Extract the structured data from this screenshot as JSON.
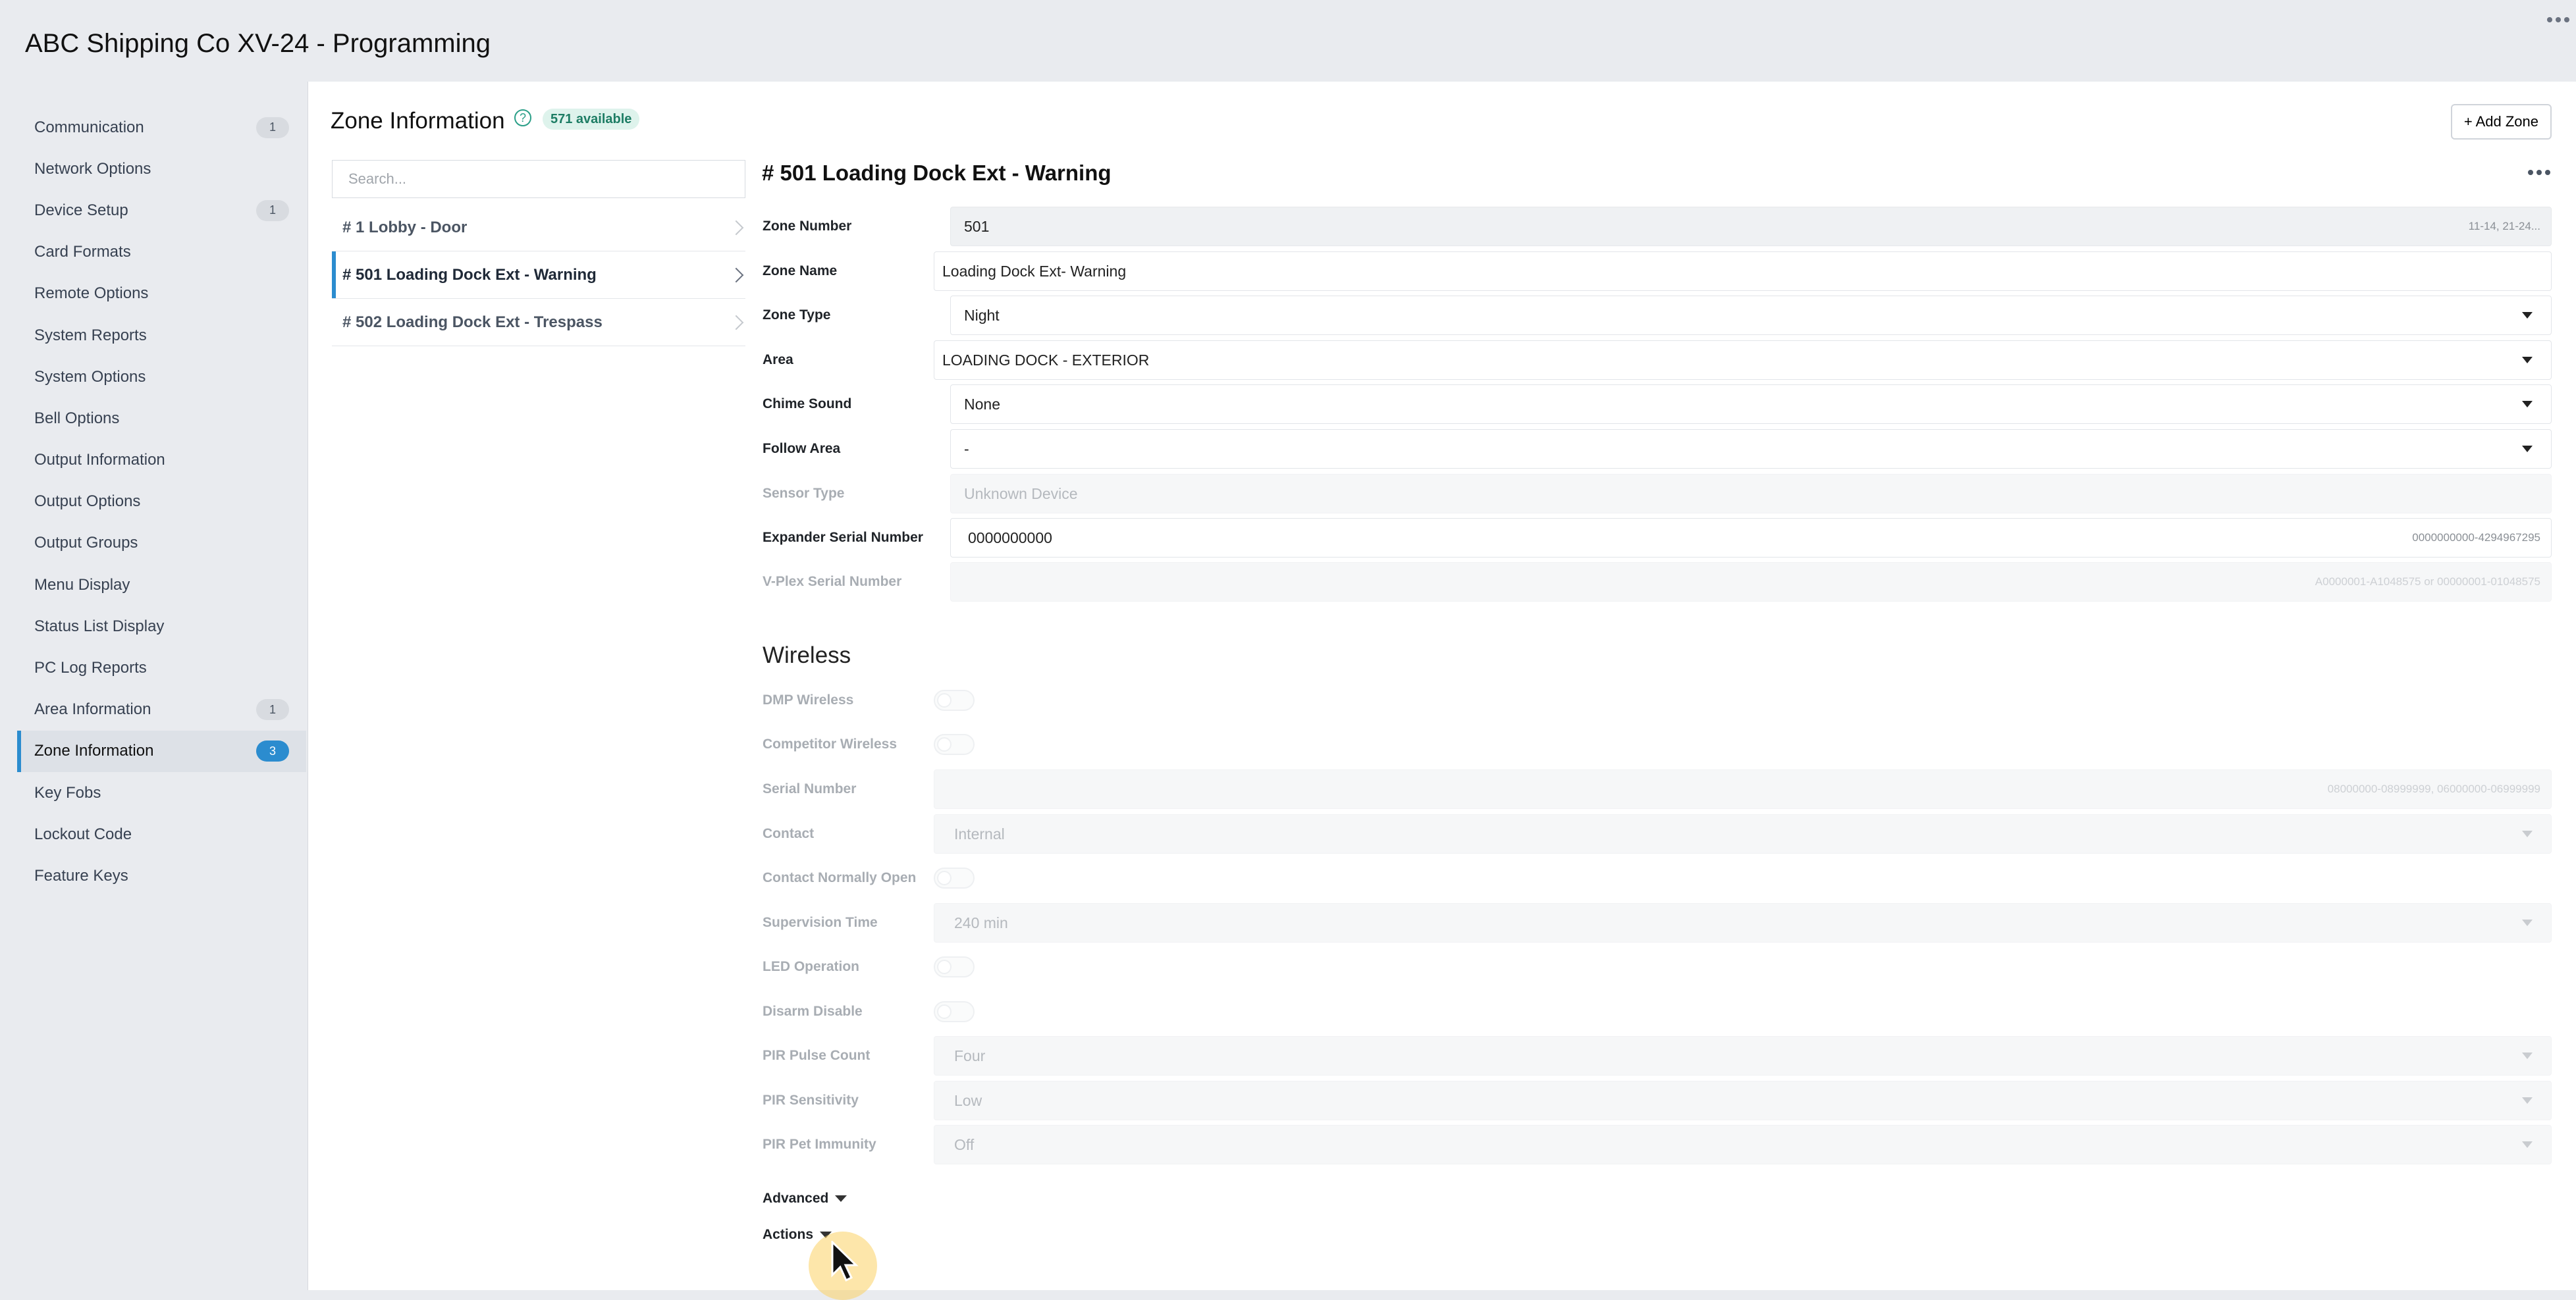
{
  "app": {
    "title": "ABC Shipping Co XV-24 - Programming"
  },
  "sidebar": {
    "items": [
      {
        "label": "Communication",
        "badge": "1"
      },
      {
        "label": "Network Options",
        "badge": ""
      },
      {
        "label": "Device Setup",
        "badge": "1"
      },
      {
        "label": "Card Formats",
        "badge": ""
      },
      {
        "label": "Remote Options",
        "badge": ""
      },
      {
        "label": "System Reports",
        "badge": ""
      },
      {
        "label": "System Options",
        "badge": ""
      },
      {
        "label": "Bell Options",
        "badge": ""
      },
      {
        "label": "Output Information",
        "badge": ""
      },
      {
        "label": "Output Options",
        "badge": ""
      },
      {
        "label": "Output Groups",
        "badge": ""
      },
      {
        "label": "Menu Display",
        "badge": ""
      },
      {
        "label": "Status List Display",
        "badge": ""
      },
      {
        "label": "PC Log Reports",
        "badge": ""
      },
      {
        "label": "Area Information",
        "badge": "1"
      },
      {
        "label": "Zone Information",
        "badge": "3"
      },
      {
        "label": "Key Fobs",
        "badge": ""
      },
      {
        "label": "Lockout Code",
        "badge": ""
      },
      {
        "label": "Feature Keys",
        "badge": ""
      }
    ],
    "active_index": 15
  },
  "header": {
    "title": "Zone Information",
    "help_icon": "?",
    "available_badge": "571 available",
    "add_button": "+ Add Zone"
  },
  "zone_list": {
    "search_placeholder": "Search...",
    "items": [
      "# 1 Lobby - Door",
      "# 501 Loading Dock Ext - Warning",
      "# 502 Loading Dock Ext - Trespass"
    ],
    "active_index": 1
  },
  "form": {
    "heading": "# 501 Loading Dock Ext - Warning",
    "fields": {
      "zone_number": {
        "label": "Zone Number",
        "value": "501",
        "hint": "11-14, 21-24..."
      },
      "zone_name": {
        "label": "Zone Name",
        "value": "Loading Dock Ext- Warning"
      },
      "zone_type": {
        "label": "Zone Type",
        "value": "Night"
      },
      "area": {
        "label": "Area",
        "value": "LOADING DOCK - EXTERIOR"
      },
      "chime_sound": {
        "label": "Chime Sound",
        "value": "None"
      },
      "follow_area": {
        "label": "Follow Area",
        "value": "-"
      },
      "sensor_type": {
        "label": "Sensor Type",
        "value": "Unknown Device"
      },
      "expander_serial": {
        "label": "Expander Serial Number",
        "value": "0000000000",
        "hint": "0000000000-4294967295"
      },
      "vplex_serial": {
        "label": "V-Plex Serial Number",
        "value": "",
        "hint": "A0000001-A1048575 or 00000001-01048575"
      }
    }
  },
  "wireless": {
    "heading": "Wireless",
    "dmp_wireless": {
      "label": "DMP Wireless"
    },
    "competitor_wireless": {
      "label": "Competitor Wireless"
    },
    "serial_number": {
      "label": "Serial Number",
      "hint": "08000000-08999999, 06000000-06999999"
    },
    "contact": {
      "label": "Contact",
      "value": "Internal"
    },
    "contact_normally_open": {
      "label": "Contact Normally Open"
    },
    "supervision_time": {
      "label": "Supervision Time",
      "value": "240 min"
    },
    "led_operation": {
      "label": "LED Operation"
    },
    "disarm_disable": {
      "label": "Disarm Disable"
    },
    "pir_pulse_count": {
      "label": "PIR Pulse Count",
      "value": "Four"
    },
    "pir_sensitivity": {
      "label": "PIR Sensitivity",
      "value": "Low"
    },
    "pir_pet_immunity": {
      "label": "PIR Pet Immunity",
      "value": "Off"
    }
  },
  "sections": {
    "advanced": "Advanced",
    "actions": "Actions"
  },
  "colors": {
    "accent": "#2b8ccf",
    "available_badge_bg": "#def3ec",
    "available_badge_text": "#1d7d64",
    "page_bg": "#e9ebef"
  }
}
